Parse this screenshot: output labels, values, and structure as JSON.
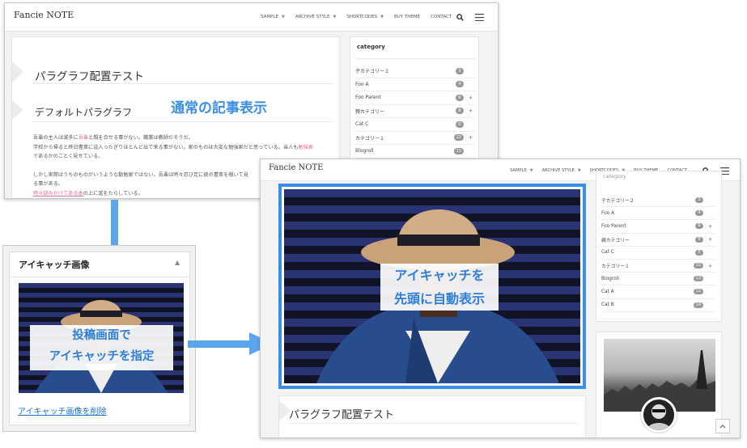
{
  "brand": "Fancie NOTE",
  "nav": [
    "SAMPLE",
    "ARCHIVE STYLE",
    "SHORTCODES",
    "BUY THEME",
    "CONTACT"
  ],
  "back_window": {
    "post_title": "パラグラフ配置テスト",
    "section_heading": "デフォルトパラグラフ",
    "overlay_label": "通常の記事表示",
    "body_line1_a": "吾輩の主人は滅多に",
    "body_line1_link": "吾輩",
    "body_line1_b": "と顔を合せる事がない。職業は教師だそうだ。",
    "body_line2_a": "学校から帰ると終日書斎に這入ったぎりほとんど出て来る事がない。家のものは大変な勉強家だと思っている。当人も",
    "body_line2_link": "勉強家",
    "body_line3": "であるかのごとく見せている。",
    "body_line4": "しかし実際はうちのものがいうような勤勉家ではない。吾輩は時々忍び足に彼の書斎を覗いて見",
    "body_line5": "る事がある。",
    "body_line6_link": "時々読みかけてある本",
    "body_line6_b": "の上に涎をたらしている。",
    "widget_title": "category",
    "categories": [
      {
        "label": "子カテゴリー２",
        "count": "3",
        "plus": false
      },
      {
        "label": "Foo A",
        "count": "4",
        "plus": false
      },
      {
        "label": "Foo Parent",
        "count": "6",
        "plus": true
      },
      {
        "label": "親カテゴリー",
        "count": "8",
        "plus": true
      },
      {
        "label": "Cat C",
        "count": "5",
        "plus": false
      },
      {
        "label": "カテゴリー１",
        "count": "22",
        "plus": true
      },
      {
        "label": "Blogroll",
        "count": "13",
        "plus": false
      }
    ]
  },
  "editor_panel": {
    "title": "アイキャッチ画像",
    "toggle": "▲",
    "callout_line1": "投稿画面で",
    "callout_line2": "アイキャッチを指定",
    "remove_link": "アイキャッチ画像を削除"
  },
  "front_window": {
    "callout_line1": "アイキャッチを",
    "callout_line2": "先頭に自動表示",
    "post_title": "パラグラフ配置テスト",
    "widget_title_partial": "category",
    "categories": [
      {
        "label": "子カテゴリー２",
        "count": "3",
        "plus": false
      },
      {
        "label": "Foo A",
        "count": "4",
        "plus": false
      },
      {
        "label": "Foo Parent",
        "count": "6",
        "plus": true
      },
      {
        "label": "親カテゴリー",
        "count": "8",
        "plus": true
      },
      {
        "label": "Cat C",
        "count": "5",
        "plus": false
      },
      {
        "label": "カテゴリー１",
        "count": "22",
        "plus": true
      },
      {
        "label": "Blogroll",
        "count": "13",
        "plus": false
      },
      {
        "label": "Cat A",
        "count": "12",
        "plus": false
      },
      {
        "label": "Cat B",
        "count": "14",
        "plus": false
      }
    ]
  },
  "icons": {
    "search": "search-icon",
    "menu": "hamburger-menu-icon",
    "scroll_top": "chevron-up-icon"
  },
  "colors": {
    "accent_blue": "#3a8ee6",
    "link_pink": "#e46a8a",
    "badge_gray": "#999999",
    "photo_stripe_blue": "#2a3475"
  }
}
